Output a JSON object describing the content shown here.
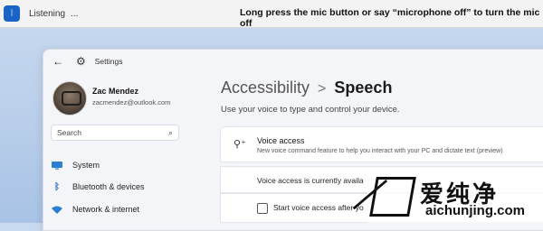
{
  "voice_bar": {
    "status": "Listening",
    "dots": "...",
    "hint": "Long press the mic button or say “microphone off” to turn the mic off",
    "accent": "#1a63c7"
  },
  "window": {
    "title": "Settings",
    "user": {
      "name": "Zac Mendez",
      "email": "zacmendez@outlook.com"
    },
    "search": {
      "label": "Search"
    },
    "nav": [
      {
        "label": "System",
        "icon": "monitor-icon"
      },
      {
        "label": "Bluetooth & devices",
        "icon": "bluetooth-icon"
      },
      {
        "label": "Network & internet",
        "icon": "wifi-icon"
      }
    ]
  },
  "main": {
    "breadcrumb_parent": "Accessibility",
    "breadcrumb_sep": ">",
    "breadcrumb_current": "Speech",
    "description": "Use your voice to type and control your device.",
    "voice_access": {
      "title": "Voice access",
      "description": "New voice command feature to help you interact with your PC and dictate text (preview)"
    },
    "status_text": "Voice access is currently availa",
    "start_checkbox_label": "Start voice access after yo"
  },
  "watermark": {
    "chinese": "爱纯净",
    "url": "aichunjing.com"
  }
}
